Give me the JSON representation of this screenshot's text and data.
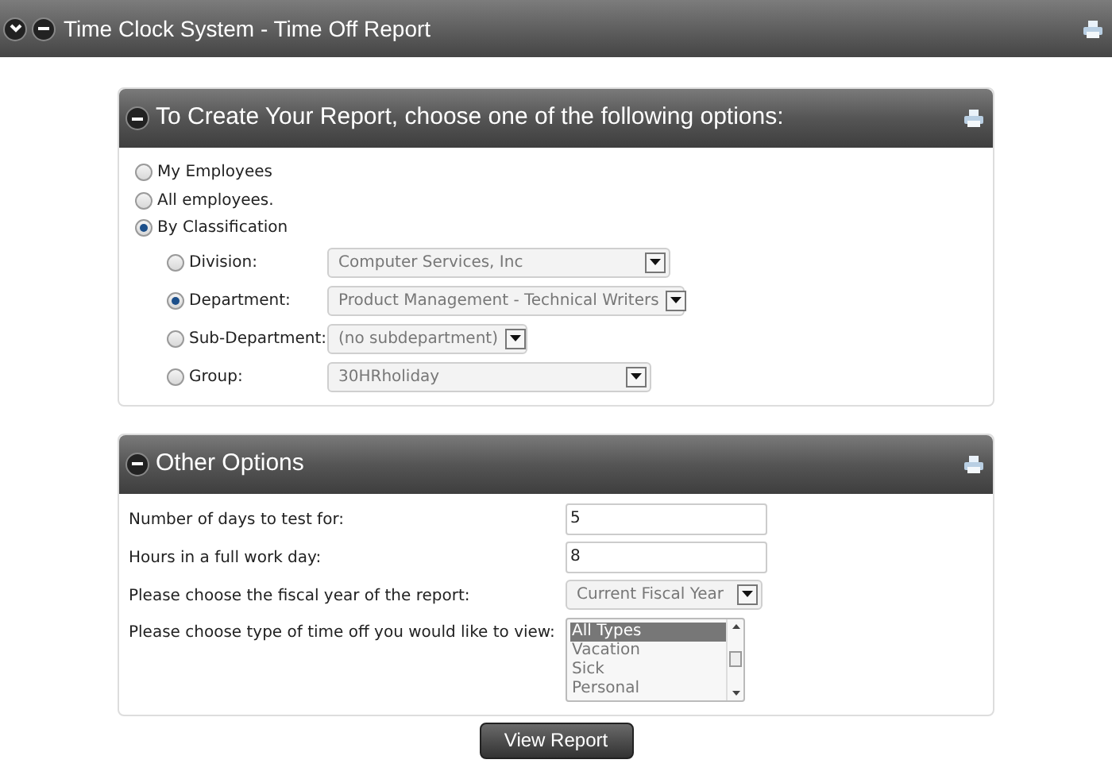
{
  "window": {
    "title": "Time Clock System - Time Off Report"
  },
  "report_panel": {
    "title": "To Create Your Report, choose one of the following options:",
    "scopes": [
      {
        "label": "My Employees",
        "selected": false
      },
      {
        "label": "All employees.",
        "selected": false
      },
      {
        "label": "By Classification",
        "selected": true
      }
    ],
    "classifications": [
      {
        "label": "Division:",
        "selected": false,
        "value": "Computer Services, Inc"
      },
      {
        "label": "Department:",
        "selected": true,
        "value": "Product Management - Technical Writers"
      },
      {
        "label": "Sub-Department:",
        "selected": false,
        "value": "(no subdepartment)"
      },
      {
        "label": "Group:",
        "selected": false,
        "value": "30HRholiday"
      }
    ]
  },
  "other_panel": {
    "title": "Other Options",
    "fields": [
      {
        "kind": "input",
        "label": "Number of days to test for:",
        "value": "5"
      },
      {
        "kind": "input",
        "label": "Hours in a full work day:",
        "value": "8"
      },
      {
        "kind": "select",
        "label": "Please choose the fiscal year of the report:",
        "value": "Current Fiscal Year"
      },
      {
        "kind": "list",
        "label": "Please choose type of time off you would like to view:",
        "options": [
          {
            "label": "All Types",
            "selected": true
          },
          {
            "label": "Vacation",
            "selected": false
          },
          {
            "label": "Sick",
            "selected": false
          },
          {
            "label": "Personal",
            "selected": false
          }
        ]
      }
    ]
  },
  "buttons": [
    "View Report"
  ]
}
